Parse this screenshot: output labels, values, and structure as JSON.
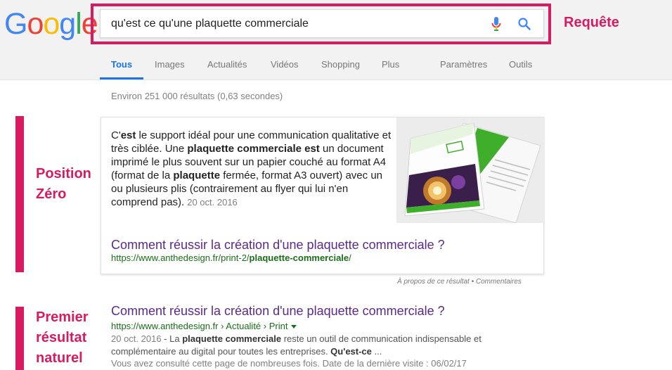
{
  "logo": {
    "letters": [
      "G",
      "o",
      "o",
      "g",
      "l",
      "e"
    ],
    "colors": [
      "#4285f4",
      "#ea4335",
      "#fbbc05",
      "#4285f4",
      "#34a853",
      "#ea4335"
    ]
  },
  "search": {
    "query": "qu'est ce qu'une plaquette commerciale"
  },
  "annotations": {
    "query_label": "Requête",
    "zero_line1": "Position",
    "zero_line2": "Zéro",
    "natural_line1": "Premier",
    "natural_line2": "résultat",
    "natural_line3": "naturel",
    "accent_color": "#d81b60"
  },
  "tabs": [
    {
      "label": "Tous"
    },
    {
      "label": "Images"
    },
    {
      "label": "Actualités"
    },
    {
      "label": "Vidéos"
    },
    {
      "label": "Shopping"
    },
    {
      "label": "Plus"
    },
    {
      "label": "Paramètres"
    },
    {
      "label": "Outils"
    }
  ],
  "stats": "Environ 251 000 résultats (0,63 secondes)",
  "featured": {
    "snippet_parts": [
      {
        "t": "C'",
        "b": false
      },
      {
        "t": "est",
        "b": true
      },
      {
        "t": " le support idéal pour une communication qualitative et très ciblée. Une ",
        "b": false
      },
      {
        "t": "plaquette commerciale",
        "b": true
      },
      {
        "t": " ",
        "b": false
      },
      {
        "t": "est",
        "b": true
      },
      {
        "t": " un document imprimé le plus souvent sur un papier couché au format A4 (format de la ",
        "b": false
      },
      {
        "t": "plaquette",
        "b": true
      },
      {
        "t": " fermée, format A3 ouvert) avec un ou plusieurs plis (contrairement au flyer qui lui n'en comprend pas).",
        "b": false
      }
    ],
    "date": "20 oct. 2016",
    "title": "Comment réussir la création d'une plaquette commerciale ?",
    "url_prefix": "https://www.anthedesign.fr/print-2/",
    "url_bold": "plaquette-commerciale",
    "url_suffix": "/",
    "about": "À propos de ce résultat • Commentaires"
  },
  "organic": {
    "title": "Comment réussir la création d'une plaquette commerciale ?",
    "breadcrumb": "https://www.anthedesign.fr › Actualité › Print",
    "date": "20 oct. 2016",
    "desc_parts": [
      {
        "t": " - La ",
        "b": false
      },
      {
        "t": "plaquette commerciale",
        "b": true
      },
      {
        "t": " reste un outil de communication indispensable et complémentaire au digital pour toutes les entreprises. ",
        "b": false
      },
      {
        "t": "Qu'est-ce",
        "b": true
      },
      {
        "t": " ...",
        "b": false
      }
    ],
    "visited": "Vous avez consulté cette page de nombreuses fois. Date de la dernière visite : 06/02/17"
  }
}
